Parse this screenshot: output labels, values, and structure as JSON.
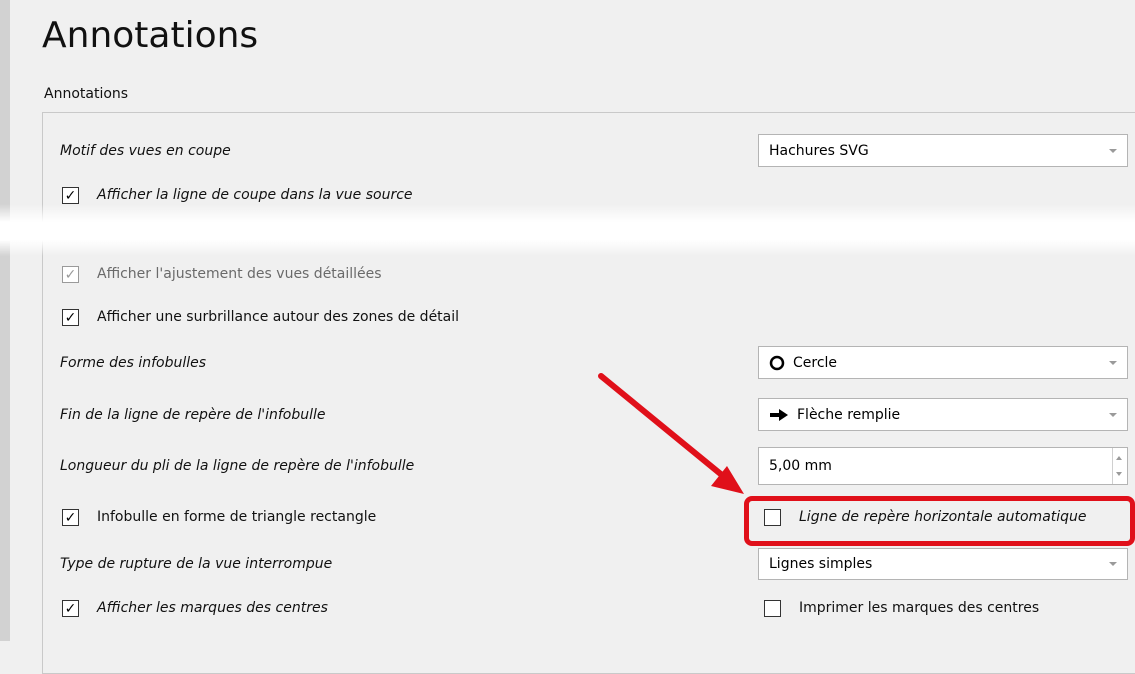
{
  "page": {
    "title": "Annotations"
  },
  "group": {
    "title": "Annotations"
  },
  "rows": {
    "section_view_pattern": {
      "label": "Motif des vues en coupe",
      "value": "Hachures SVG"
    },
    "show_section_line": {
      "label": "Afficher la ligne de coupe dans la vue source",
      "checked": true
    },
    "show_detail_fit": {
      "label": "Afficher l'ajustement des vues détaillées",
      "checked": true
    },
    "show_detail_highlight": {
      "label": "Afficher une surbrillance autour des zones de détail",
      "checked": true
    },
    "balloon_shape": {
      "label": "Forme des infobulles",
      "value": "Cercle",
      "icon": "circle-icon"
    },
    "balloon_leader_end": {
      "label": "Fin de la ligne de repère de l'infobulle",
      "value": "Flèche remplie",
      "icon": "filled-arrow-icon"
    },
    "balloon_kink_length": {
      "label": "Longueur du pli de la ligne de repère de l'infobulle",
      "value": "5,00 mm"
    },
    "balloon_triangle": {
      "label": "Infobulle en forme de triangle rectangle",
      "checked": true
    },
    "auto_horizontal_leader": {
      "label": "Ligne de repère horizontale automatique",
      "checked": false
    },
    "break_type": {
      "label": "Type de rupture de la vue interrompue",
      "value": "Lignes simples"
    },
    "show_center_marks": {
      "label": "Afficher les marques des centres",
      "checked": true
    },
    "print_center_marks": {
      "label": "Imprimer les marques des centres",
      "checked": false
    }
  },
  "annotation": {
    "arrow_color": "#e0101a",
    "highlight_color": "#e0101a"
  }
}
